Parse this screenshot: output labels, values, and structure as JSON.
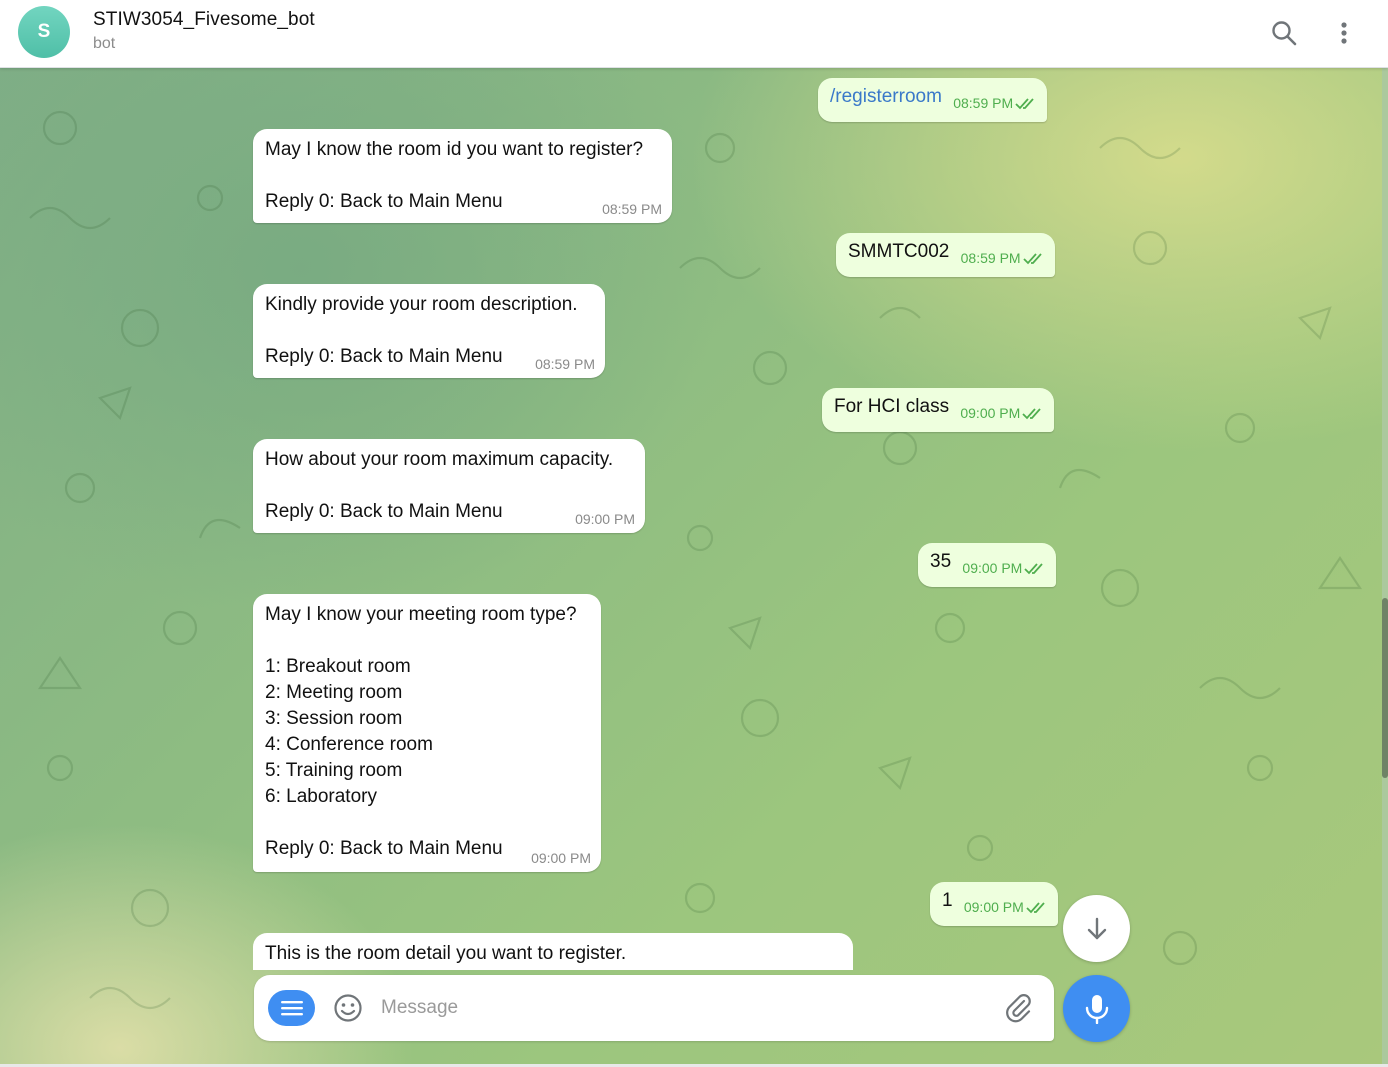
{
  "header": {
    "avatar_letter": "S",
    "title": "STIW3054_Fivesome_bot",
    "subtitle": "bot",
    "icons": [
      "search-icon",
      "more-vertical-icon"
    ]
  },
  "messages": [
    {
      "direction": "out",
      "text": "/registerroom",
      "time": "08:59 PM",
      "is_command": true
    },
    {
      "direction": "in",
      "text": "May I know the room id you want to register?\n\nReply 0: Back to Main Menu",
      "time": "08:59 PM"
    },
    {
      "direction": "out",
      "text": "SMMTC002",
      "time": "08:59 PM"
    },
    {
      "direction": "in",
      "text": "Kindly provide your room description.\n\nReply 0: Back to Main Menu",
      "time": "08:59 PM"
    },
    {
      "direction": "out",
      "text": "For HCI class",
      "time": "09:00 PM"
    },
    {
      "direction": "in",
      "text": "How about your room maximum capacity.\n\nReply 0: Back to Main Menu",
      "time": "09:00 PM"
    },
    {
      "direction": "out",
      "text": "35",
      "time": "09:00 PM"
    },
    {
      "direction": "in",
      "text": "May I know your meeting room type?\n\n1: Breakout room\n2: Meeting room\n3: Session room\n4: Conference room\n5: Training room\n6: Laboratory\n\nReply 0: Back to Main Menu",
      "time": "09:00 PM"
    },
    {
      "direction": "out",
      "text": "1",
      "time": "09:00 PM"
    },
    {
      "direction": "in",
      "text": "This is the room detail you want to register.",
      "time": ""
    }
  ],
  "composer": {
    "placeholder": "Message",
    "icons": [
      "menu-icon",
      "emoji-icon",
      "attach-icon",
      "mic-icon",
      "arrow-down-icon"
    ]
  },
  "colors": {
    "accent": "#3f8ef2",
    "outgoing_bubble": "#eeffde",
    "incoming_bubble": "#ffffff",
    "read_ticks": "#4fae4e",
    "command_link": "#3a79c9",
    "avatar": "#5cc9b1"
  }
}
